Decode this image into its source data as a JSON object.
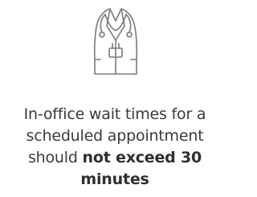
{
  "icon": {
    "name": "doctor-coat-stethoscope-icon",
    "stroke_color": "#7a7a7a"
  },
  "caption": {
    "line1": "In-office wait times for a",
    "line2": "scheduled appointment",
    "line3_prefix": "should ",
    "emphasis_part1": "not exceed 30",
    "emphasis_part2": "minutes"
  },
  "colors": {
    "text": "#3a3a3a",
    "background": "#ffffff"
  }
}
